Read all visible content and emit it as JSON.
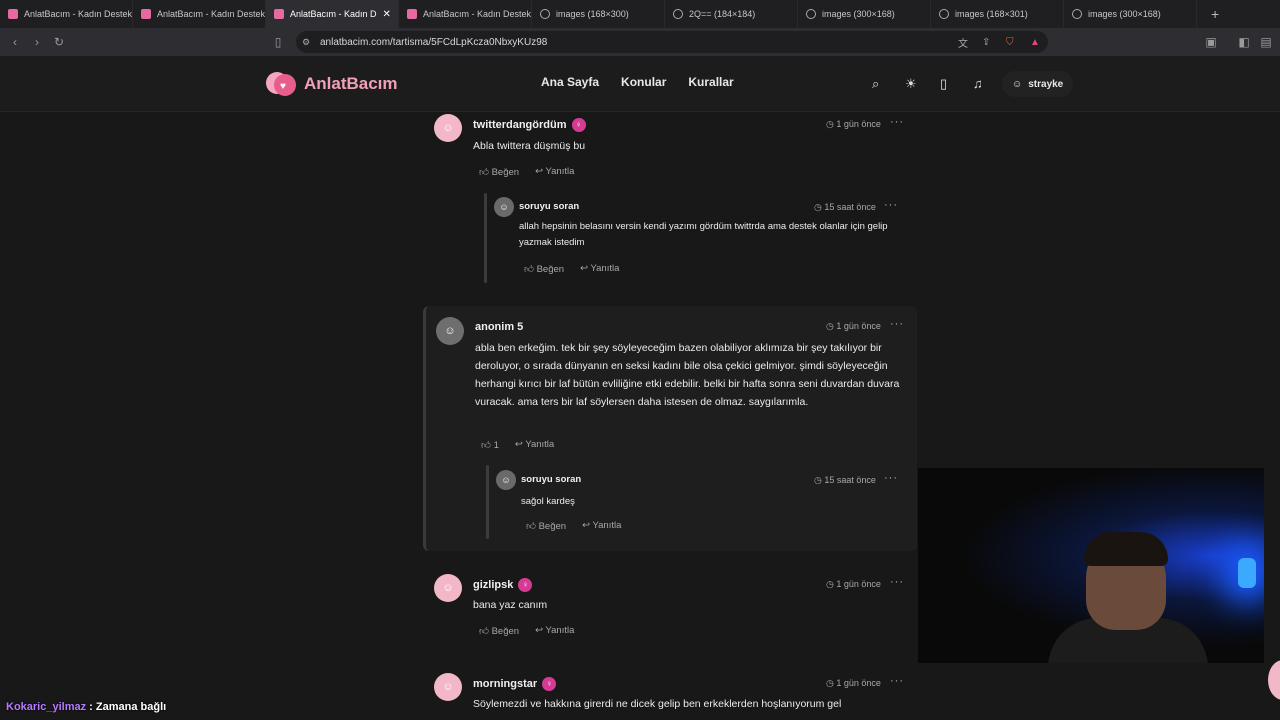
{
  "browser": {
    "tabs": [
      {
        "title": "AnlatBacım - Kadın Destek",
        "icon": "site-favicon",
        "active": false
      },
      {
        "title": "AnlatBacım - Kadın Destek",
        "icon": "site-favicon",
        "active": false
      },
      {
        "title": "AnlatBacım - Kadın D",
        "icon": "site-favicon",
        "active": true
      },
      {
        "title": "AnlatBacım - Kadın Destek",
        "icon": "site-favicon",
        "active": false
      },
      {
        "title": "images (168×300)",
        "icon": "globe-icon",
        "active": false
      },
      {
        "title": "2Q== (184×184)",
        "icon": "globe-icon",
        "active": false
      },
      {
        "title": "images (300×168)",
        "icon": "globe-icon",
        "active": false
      },
      {
        "title": "images (168×301)",
        "icon": "globe-icon",
        "active": false
      },
      {
        "title": "images (300×168)",
        "icon": "globe-icon",
        "active": false
      }
    ],
    "url": "anlatbacim.com/tartisma/5FCdLpKcza0NbxyKUz98"
  },
  "site": {
    "logo_text": "AnlatBacım",
    "nav": [
      "Ana Sayfa",
      "Konular",
      "Kurallar"
    ],
    "username": "strayke"
  },
  "comments": [
    {
      "user": "twitterdangördüm",
      "time": "1 gün önce",
      "text": "Abla twittera düşmüş bu",
      "like_label": "Beğen",
      "reply_label": "Yanıtla",
      "replies": [
        {
          "user": "soruyu soran",
          "time": "15 saat önce",
          "text": "allah hepsinin belasını versin kendi yazımı gördüm twittrda ama destek olanlar için gelip yazmak istedim",
          "like_label": "Beğen",
          "reply_label": "Yanıtla"
        }
      ]
    },
    {
      "user": "anonim 5",
      "time": "1 gün önce",
      "text": "abla ben erkeğim. tek bir şey söyleyeceğim bazen olabiliyor aklımıza bir şey takılıyor bir deroluyor, o sırada dünyanın en seksi kadını bile olsa çekici gelmiyor. şimdi söyleyeceğin herhangi kırıcı bir laf bütün evliliğine etki edebilir. belki bir hafta sonra seni duvardan duvara vuracak. ama ters bir laf söylersen daha istesen de olmaz. saygılarımla.",
      "like_count": "1",
      "reply_label": "Yanıtla",
      "replies": [
        {
          "user": "soruyu soran",
          "time": "15 saat önce",
          "text": "sağol kardeş",
          "like_label": "Beğen",
          "reply_label": "Yanıtla"
        }
      ]
    },
    {
      "user": "gizlipsk",
      "time": "1 gün önce",
      "text": "bana yaz canım",
      "like_label": "Beğen",
      "reply_label": "Yanıtla"
    },
    {
      "user": "morningstar",
      "time": "1 gün önce",
      "text": "Söylemezdi ve hakkına girerdi ne dicek gelip ben erkeklerden hoşlanıyorum gel"
    }
  ],
  "stream_chat": {
    "user": "Kokaric_yilmaz",
    "message": ": Zamana bağlı"
  },
  "colors": {
    "accent_pink": "#e85d8c",
    "badge_magenta": "#d63b93",
    "chat_user_purple": "#b57bff"
  }
}
